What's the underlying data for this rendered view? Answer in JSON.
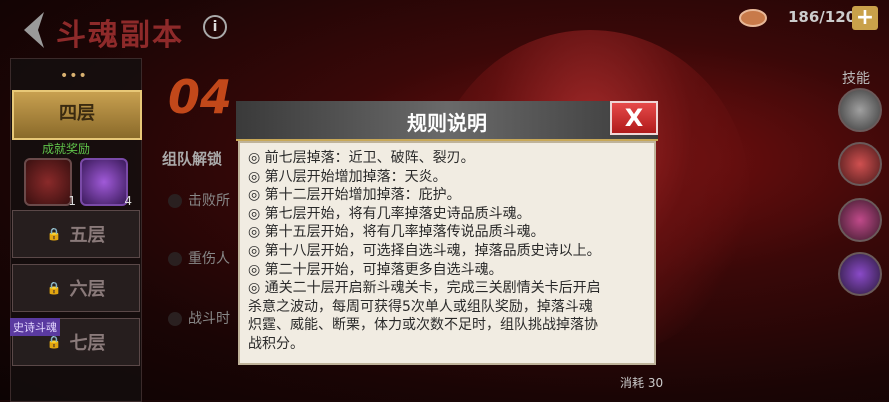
{
  "header": {
    "title": "斗魂副本",
    "info_icon": "i",
    "stamina": "186/120",
    "plus_label": "+"
  },
  "left": {
    "dots": "•••",
    "selected_floor": "四层",
    "reward_label": "成就奖励",
    "rewards": [
      {
        "count": "1"
      },
      {
        "count": "4"
      }
    ],
    "floors": [
      "五层",
      "六层",
      "七层"
    ],
    "soul_tag": "史诗斗魂"
  },
  "main": {
    "floor_number": "04",
    "team_label": "组队解锁",
    "tasks": [
      "击败所",
      "重伤人",
      "战斗时"
    ]
  },
  "right": {
    "skill_label": "技能"
  },
  "footer": {
    "cost_label": "消耗",
    "cost_value": "30"
  },
  "dialog": {
    "title": "规则说明",
    "close_label": "X",
    "rules": [
      "◎ 前七层掉落：近卫、破阵、裂刃。",
      "◎ 第八层开始增加掉落：天炎。",
      "◎ 第十二层开始增加掉落：庇护。",
      "◎ 第七层开始，将有几率掉落史诗品质斗魂。",
      "◎ 第十五层开始，将有几率掉落传说品质斗魂。",
      "◎ 第十八层开始，可选择自选斗魂，掉落品质史诗以上。",
      "◎ 第二十层开始，可掉落更多自选斗魂。",
      "◎ 通关二十层开启新斗魂关卡，完成三关剧情关卡后开启",
      "杀意之波动，每周可获得5次单人或组队奖励，掉落斗魂",
      "炽霆、威能、断栗，体力或次数不足时，组队挑战掉落协",
      "战积分。"
    ]
  },
  "colors": {
    "accent_gold": "#c8a050",
    "close_red": "#d03030",
    "reward_green": "#5fc24a"
  }
}
